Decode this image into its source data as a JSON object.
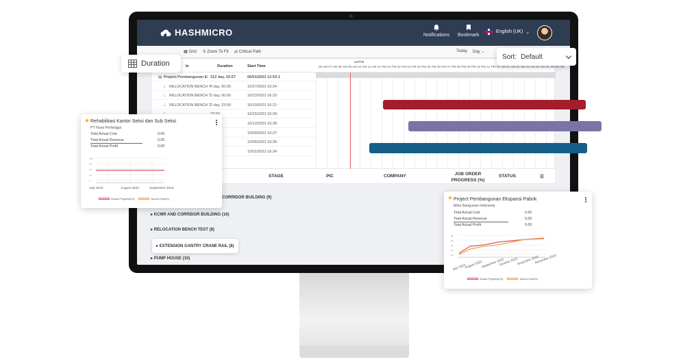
{
  "header": {
    "logo": "HASHMICRO",
    "notifications_label": "Notifications",
    "bookmark_label": "Bookmark",
    "language": "English (UK)"
  },
  "toolbar": {
    "grid_label": "Grid",
    "zoom_label": "Zoom To Fit",
    "critical_label": "Critical Path",
    "today_label": "Today",
    "scale_label": "Day"
  },
  "duration_chip": {
    "label": "Duration"
  },
  "sort": {
    "prefix": "Sort:",
    "value": "Default"
  },
  "gantt": {
    "col_title": "le",
    "col_duration": "Duration",
    "col_start": "Start Time",
    "date_label": "22/Thh",
    "hours": "06 AM 07 AM 08 AM 09 AM 10 AM 11 AM 12 PM 01 PM 02 PM 03 PM 04 PM 05 PM 06 PM 07 PM 08 PM 09 PM 10 PM 11 PM 00 AM 01 AM 02 AM 03 AM 04 AM 05 AM 06 AM",
    "rows": [
      {
        "name": "Project Pembangunan Eks",
        "duration": "212 day, 02:57",
        "start": "06/01/2023 12:53:1"
      },
      {
        "name": "RELOCATION BENCH T",
        "duration": "4 day, 00:00",
        "start": "10/27/2023 16:24:"
      },
      {
        "name": "RELOCATION BENCH T",
        "duration": "2 day, 00:00",
        "start": "10/23/2023 16:23:"
      },
      {
        "name": "RELOCATION BENCH T",
        "duration": "2 day, 23:59",
        "start": "10/19/2023 16:21:"
      },
      {
        "name": "",
        "duration": "23:59",
        "start": "10/15/2023 16:29:"
      },
      {
        "name": "",
        "duration": "23:59",
        "start": "10/12/2023 16:28:"
      },
      {
        "name": "",
        "duration": "00:00",
        "start": "10/09/2023 16:27:"
      },
      {
        "name": "",
        "duration": "00:00",
        "start": "10/05/2023 16:26:"
      },
      {
        "name": "",
        "duration": "00:00",
        "start": "10/01/2023 16:24:"
      }
    ]
  },
  "table": {
    "col_stage": "STAGE",
    "col_pic": "PIC",
    "col_company": "COMPANY",
    "col_progress": "JOB ORDER PROGRESS (%)",
    "col_status": "STATUS",
    "groups": [
      "CORRIDOR BUILDING (9)",
      "KCMR AND CORRIDOR BUILDING (16)",
      "RELOCATION BENCH TEST (8)",
      "EXTENSION GANTRY CRANE RAIL (8)",
      "PUMP HOUSE (10)"
    ]
  },
  "card_left": {
    "title": "Rehabilitasi Kantor Seksi dan Sub Seksi",
    "company": "PT Nusa Perlangga",
    "cost_label": "Total Actual Cost",
    "cost_value": "0.00",
    "revenue_label": "Total Actual Revenue",
    "revenue_value": "0.00",
    "profit_label": "Total Actual Profit",
    "profit_value": "0.00",
    "months": [
      "July 2023",
      "August 2023",
      "September 2023"
    ],
    "legend_progress": "Actual Progress(%)",
    "legend_cost": "Actual Cost(%)"
  },
  "card_right": {
    "title": "Project Pembangunan Ekspansi Pabrik",
    "company": "Mitra Bangunan Indonesia",
    "cost_label": "Total Actual Cost",
    "cost_value": "0.00",
    "revenue_label": "Total Actual Revenue",
    "revenue_value": "0.00",
    "profit_label": "Total Actual Profit",
    "profit_value": "0.00",
    "months": [
      "July 2023",
      "August 2023",
      "September 2023",
      "October 2023",
      "November 2023",
      "December 2023"
    ],
    "legend_progress": "Actual Progress(%)",
    "legend_cost": "Actual Cost(%)"
  },
  "colors": {
    "header_bg": "#2f3d52",
    "bar_red": "#a31d2b",
    "bar_purple": "#7a74a6",
    "bar_blue": "#165f8a",
    "progress_line": "#e05563",
    "cost_line": "#f2a04a",
    "star": "#f4b400"
  }
}
